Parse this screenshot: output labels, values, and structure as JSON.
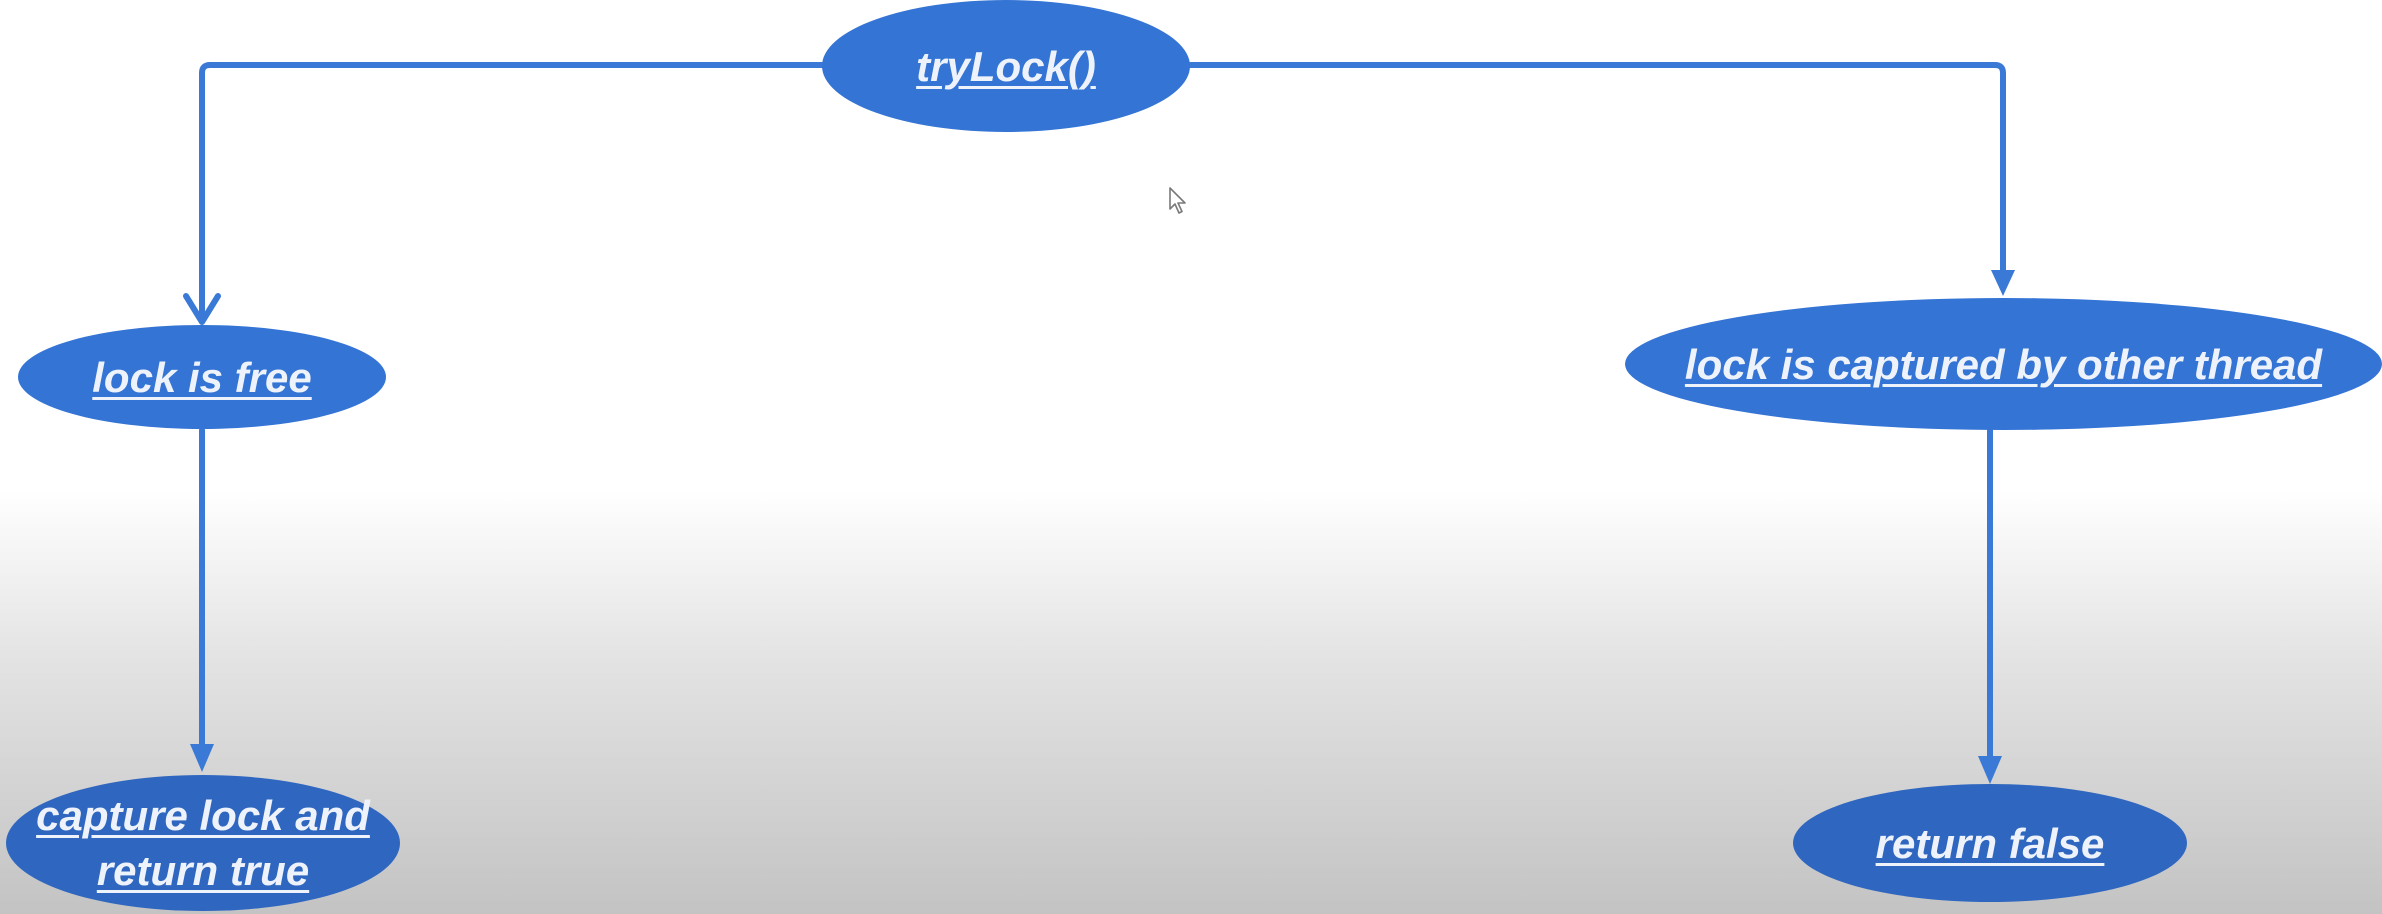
{
  "colors": {
    "node_fill": "#3474d4",
    "lower_node_fill": "#2f67c0",
    "edge": "#3a7ad6",
    "label_text": "#eef3fb"
  },
  "nodes": {
    "trylock": "tryLock()",
    "lock_free": "lock is free",
    "lock_captured": "lock is captured by other thread",
    "capture_line1": "capture lock and",
    "capture_line2": "return true",
    "return_false": "return false"
  },
  "cursor_icon": "mouse-pointer-icon"
}
